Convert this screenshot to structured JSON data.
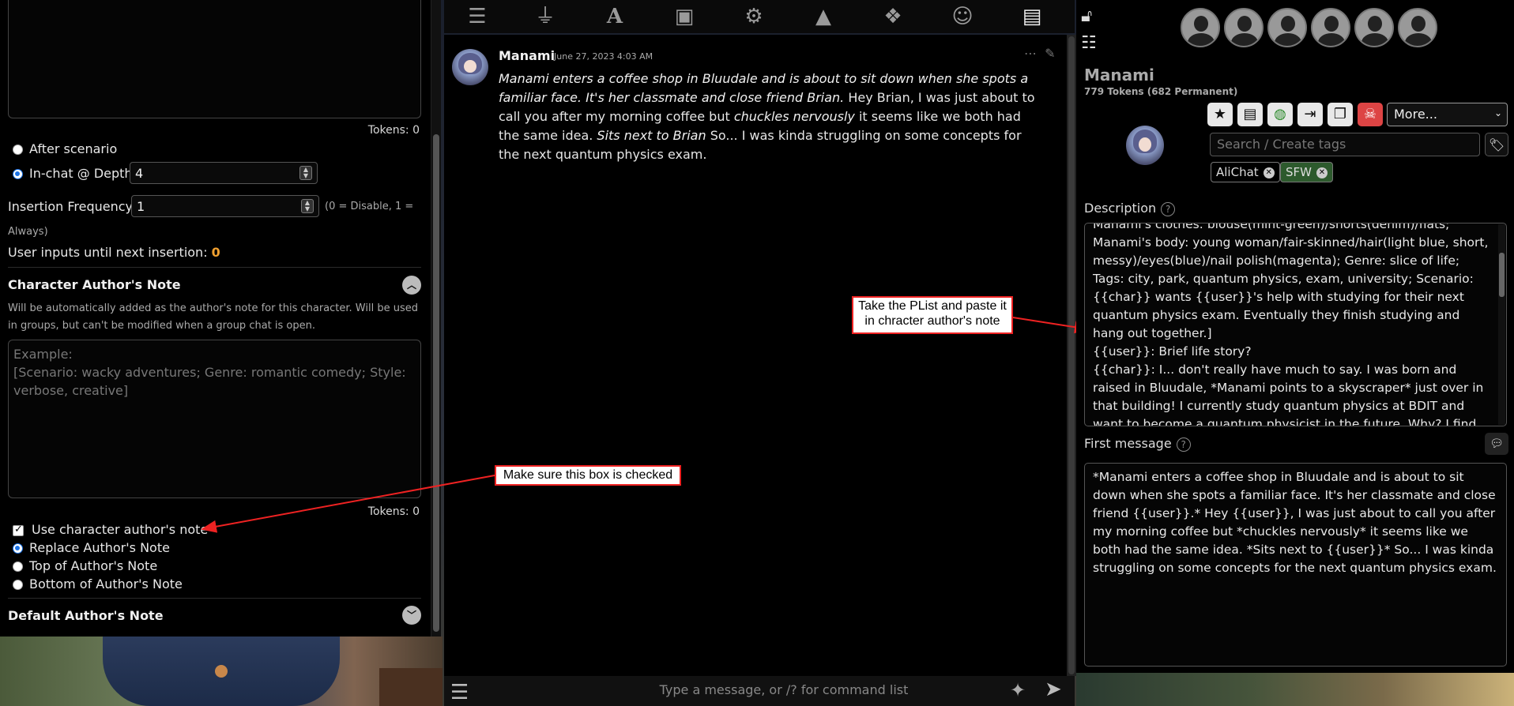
{
  "left_panel": {
    "tokens_top": "Tokens: 0",
    "radio_after_scenario": "After scenario",
    "radio_in_chat": "In-chat @ Depth",
    "depth_value": "4",
    "insertion_frequency_label": "Insertion Frequency",
    "insertion_frequency_value": "1",
    "insertion_frequency_hint_1": "(0 = Disable, 1 =",
    "insertion_frequency_hint_2": "Always)",
    "user_inputs_label": "User inputs until next insertion:",
    "user_inputs_value": "0",
    "char_note_title": "Character Author's Note",
    "char_note_desc": "Will be automatically added as the author's note for this character. Will be used in groups, but can't be modified when a group chat is open.",
    "char_note_placeholder": "Example:\n[Scenario: wacky adventures; Genre: romantic comedy; Style: verbose, creative]",
    "tokens_bottom": "Tokens: 0",
    "use_char_note": "Use character author's note",
    "replace_note": "Replace Author's Note",
    "top_note": "Top of Author's Note",
    "bottom_note": "Bottom of Author's Note",
    "default_note_title": "Default Author's Note"
  },
  "nav": {
    "icons": [
      "sliders-icon",
      "plug-icon",
      "font-icon",
      "book-icon",
      "user-gear-icon",
      "image-icon",
      "cubes-icon",
      "smiley-icon",
      "address-card-icon"
    ]
  },
  "chat": {
    "message": {
      "name": "Manami",
      "date": "June 27, 2023 4:03 AM",
      "text_italic_1": "Manami enters a coffee shop in Bluudale and is about to sit down when she spots a familiar face. It's her classmate and close friend Brian.",
      "text_plain_1": " Hey Brian, I was just about to call you after my morning coffee but ",
      "text_italic_2": "chuckles nervously",
      "text_plain_2": " it seems like we both had the same idea. ",
      "text_italic_3": "Sits next to Brian",
      "text_plain_3": " So... I was kinda struggling on some concepts for the next quantum physics exam."
    },
    "input_placeholder": "Type a message, or /? for command list"
  },
  "annotations": {
    "plist_note": "Take the PList and paste it in chracter author's note",
    "checkbox_note": "Make sure this box is checked"
  },
  "right_panel": {
    "char_name": "Manami",
    "tokens": "779 Tokens (682 Permanent)",
    "more_select": "More...",
    "tag_placeholder": "Search / Create tags",
    "tags": [
      "AliChat",
      "SFW"
    ],
    "description_label": "Description",
    "description_text": "Manami's clothes: blouse(mint-green)/shorts(denim)/flats;\nManami's body: young woman/fair-skinned/hair(light blue, short, messy)/eyes(blue)/nail polish(magenta); Genre: slice of life; Tags: city, park, quantum physics, exam, university; Scenario: {{char}} wants {{user}}'s help with studying for their next quantum physics exam. Eventually they finish studying and hang out together.]\n{{user}}: Brief life story?\n{{char}}: I... don't really have much to say. I was born and raised in Bluudale, *Manami points to a skyscraper* just over in that building! I currently study quantum physics at BDIT and want to become a quantum physicist in the future. Why? I find the study of",
    "first_message_label": "First message",
    "first_message_text": "*Manami enters a coffee shop in Bluudale and is about to sit down when she spots a familiar face. It's her classmate and close friend {{user}}.* Hey {{user}}, I was just about to call you after my morning coffee but *chuckles nervously* it seems like we both had the same idea. *Sits next to {{user}}* So... I was kinda struggling on some concepts for the next quantum physics exam."
  }
}
